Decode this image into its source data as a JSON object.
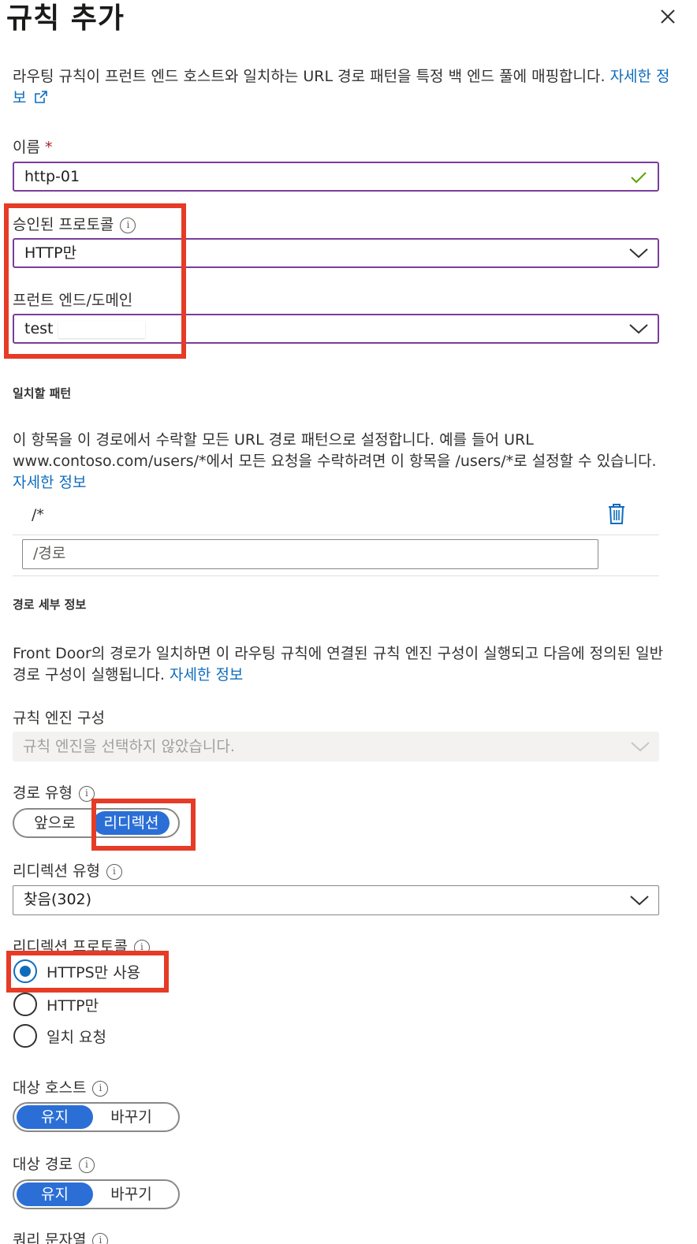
{
  "panel": {
    "title": "규칙 추가",
    "close_icon": "close-icon"
  },
  "intro": {
    "text": "라우팅 규칙이 프런트 엔드 호스트와 일치하는 URL 경로 패턴을 특정 백 엔드 풀에 매핑합니다. ",
    "link": "자세한 정보",
    "link_icon": "external-link-icon"
  },
  "name_field": {
    "label": "이름",
    "required_mark": "*",
    "value": "http-01",
    "status_icon": "checkmark-icon"
  },
  "accepted_protocol": {
    "label": "승인된 프로토콜",
    "value": "HTTP만"
  },
  "frontend": {
    "label": "프런트 엔드/도메인",
    "value": "test"
  },
  "match_pattern": {
    "heading": "일치할 패턴",
    "description": "이 항목을 이 경로에서 수락할 모든 URL 경로 패턴으로 설정합니다. 예를 들어 URL www.contoso.com/users/*에서 모든 요청을 수락하려면 이 항목을 /users/*로 설정할 수 있습니다.",
    "link": "자세한 정보",
    "patterns": [
      "/*"
    ],
    "new_placeholder": "/경로"
  },
  "route_details": {
    "heading": "경로 세부 정보",
    "description": "Front Door의 경로가 일치하면 이 라우팅 규칙에 연결된 규칙 엔진 구성이 실행되고 다음에 정의된 일반 경로 구성이 실행됩니다. ",
    "link": "자세한 정보"
  },
  "rules_engine": {
    "label": "규칙 엔진 구성",
    "placeholder": "규칙 엔진을 선택하지 않았습니다."
  },
  "route_type": {
    "label": "경로 유형",
    "options": [
      "앞으로",
      "리디렉션"
    ],
    "selected": "리디렉션"
  },
  "redirect_type": {
    "label": "리디렉션 유형",
    "value": "찾음(302)"
  },
  "redirect_protocol": {
    "label": "리디렉션 프로토콜",
    "options": [
      "HTTPS만 사용",
      "HTTP만",
      "일치 요청"
    ],
    "selected": "HTTPS만 사용"
  },
  "dest_host": {
    "label": "대상 호스트",
    "options": [
      "유지",
      "바꾸기"
    ],
    "selected": "유지"
  },
  "dest_path": {
    "label": "대상 경로",
    "options": [
      "유지",
      "바꾸기"
    ],
    "selected": "유지"
  },
  "query_string": {
    "label": "쿼리 문자열"
  },
  "colors": {
    "accent": "#0f6cbd",
    "toggle_selected": "#2b6fd6",
    "focus_border": "#7a3d9c",
    "highlight": "#e63b26",
    "valid": "#57a300"
  }
}
